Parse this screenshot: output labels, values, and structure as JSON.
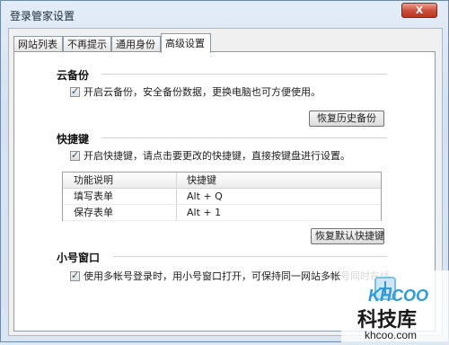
{
  "window": {
    "title": "登录管家设置",
    "close_label": "X"
  },
  "tabs": [
    {
      "label": "网站列表"
    },
    {
      "label": "不再提示"
    },
    {
      "label": "通用身份"
    },
    {
      "label": "高级设置",
      "active": true
    }
  ],
  "backup": {
    "title": "云备份",
    "checkbox_label": "开启云备份，安全备份数据，更换电脑也可方便使用。",
    "checked": true,
    "restore_button": "恢复历史备份"
  },
  "hotkeys": {
    "title": "快捷键",
    "checkbox_label": "开启快捷键，请点击要更改的快捷键，直接按键盘进行设置。",
    "checked": true,
    "columns": [
      "功能说明",
      "快捷键"
    ],
    "rows": [
      {
        "function": "填写表单",
        "key": "Alt + Q"
      },
      {
        "function": "保存表单",
        "key": "Alt + 1"
      }
    ],
    "reset_button": "恢复默认快捷键"
  },
  "small_window": {
    "title": "小号窗口",
    "checkbox_label": "使用多帐号登录时，用小号窗口打开，可保持同一网站多帐号同时在线",
    "checked": true
  },
  "watermark": {
    "brand": "KHCOO",
    "name": "科技库",
    "url": "khcoo.com"
  }
}
